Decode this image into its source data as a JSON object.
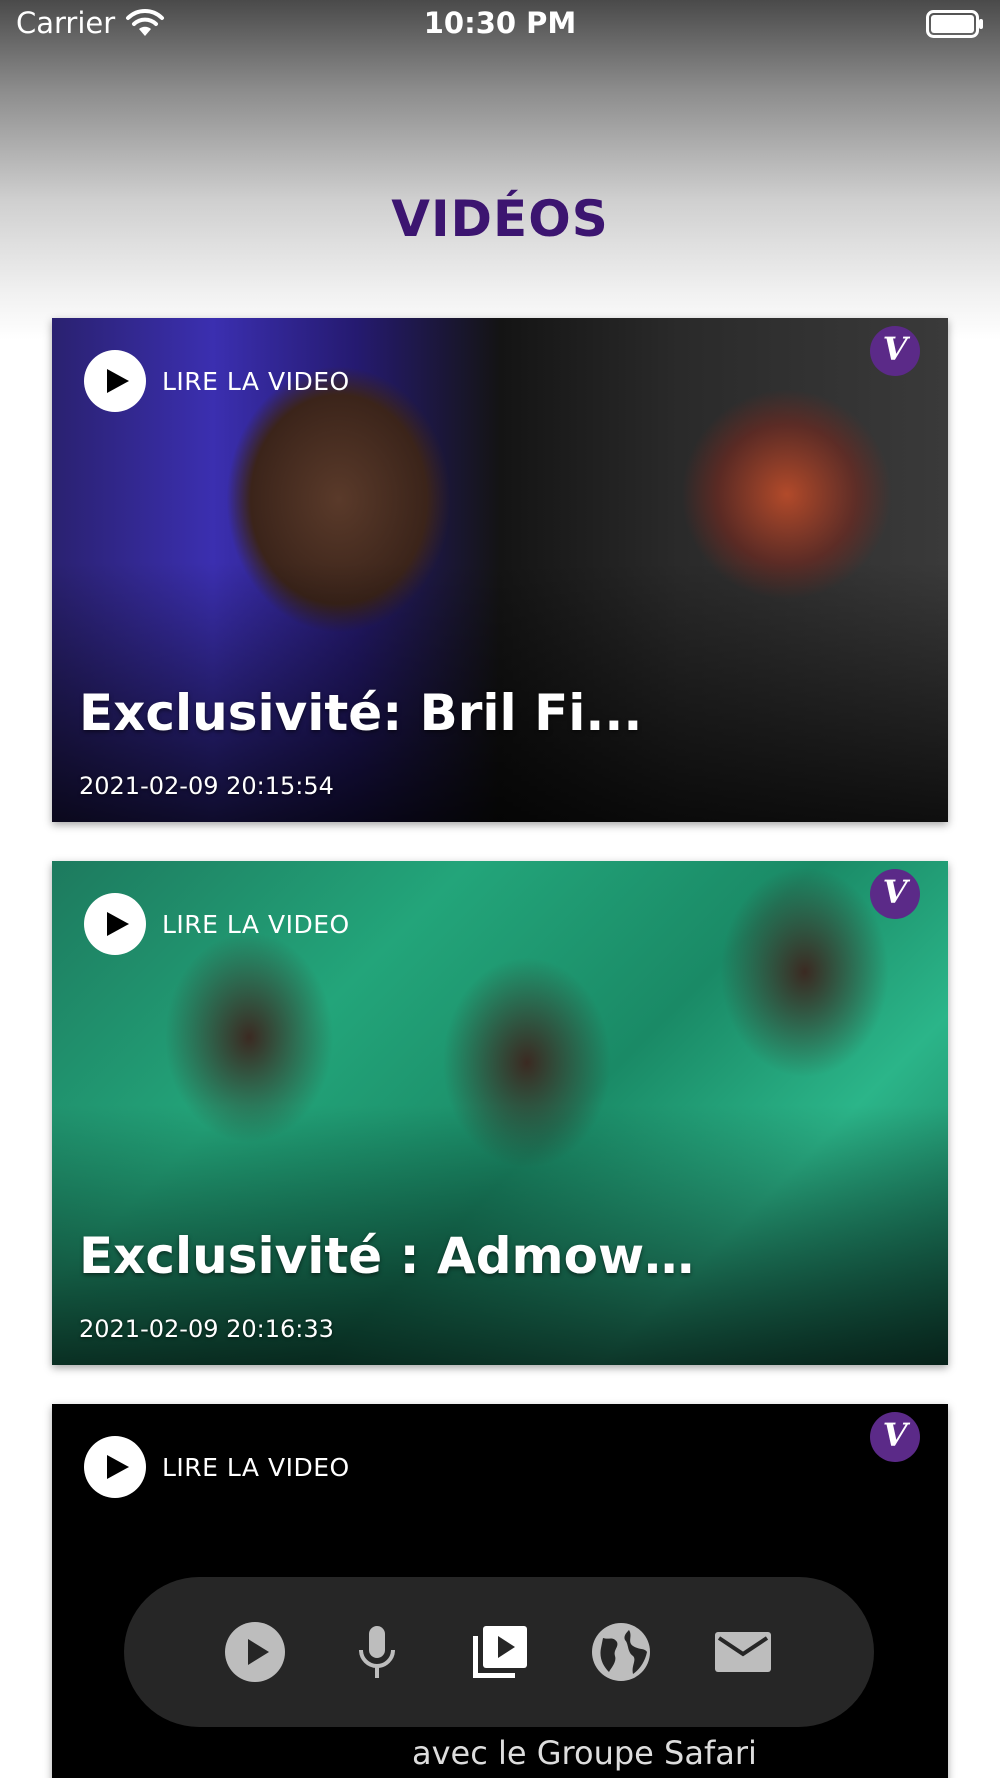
{
  "status_bar": {
    "carrier": "Carrier",
    "time": "10:30 PM"
  },
  "page": {
    "title": "VIDÉOS"
  },
  "videos": [
    {
      "play_label": "LIRE LA VIDEO",
      "title": "Exclusivité: Bril Fi...",
      "date": "2021-02-09 20:15:54",
      "logo": "V"
    },
    {
      "play_label": "LIRE LA VIDEO",
      "title": "Exclusivité : Admow ...",
      "date": "2021-02-09 20:16:33",
      "logo": "V"
    },
    {
      "play_label": "LIRE LA VIDEO",
      "caption": "avec le Groupe Safari",
      "logo": "V"
    }
  ],
  "tab_bar": {
    "items": [
      {
        "icon": "play-circle-icon",
        "active": false
      },
      {
        "icon": "microphone-icon",
        "active": false
      },
      {
        "icon": "video-library-icon",
        "active": true
      },
      {
        "icon": "globe-icon",
        "active": false
      },
      {
        "icon": "mail-icon",
        "active": false
      }
    ],
    "active_color": "#ffffff",
    "inactive_color": "#bdbdbd"
  },
  "colors": {
    "title": "#3c1570",
    "tab_bar_bg": "#262626",
    "logo_bg": "#5b2a88"
  }
}
